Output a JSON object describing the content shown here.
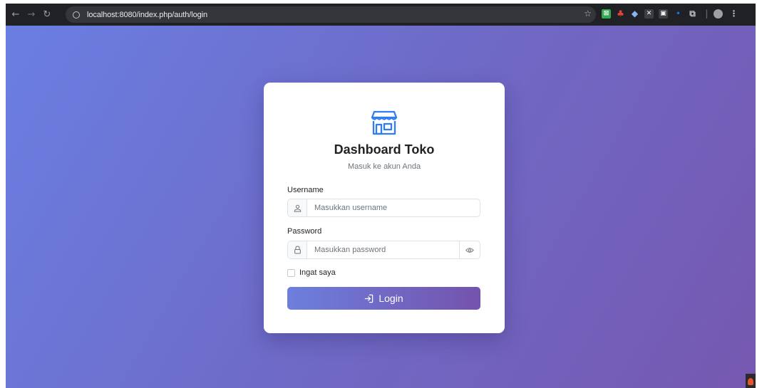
{
  "browser": {
    "url": "localhost:8080/index.php/auth/login",
    "back_icon": "arrow-left-icon",
    "forward_icon": "arrow-right-icon",
    "reload_icon": "reload-icon",
    "bookmark_icon": "star-icon"
  },
  "card": {
    "logo_icon": "store-icon",
    "title": "Dashboard Toko",
    "subtitle": "Masuk ke akun Anda"
  },
  "form": {
    "username_label": "Username",
    "username_placeholder": "Masukkan username",
    "username_value": "",
    "password_label": "Password",
    "password_placeholder": "Masukkan password",
    "password_value": "",
    "remember_label": "Ingat saya",
    "remember_checked": false,
    "submit_label": "Login"
  },
  "colors": {
    "accent_start": "#6d7fdd",
    "accent_end": "#7453ad",
    "icon_blue": "#2f7dee"
  }
}
